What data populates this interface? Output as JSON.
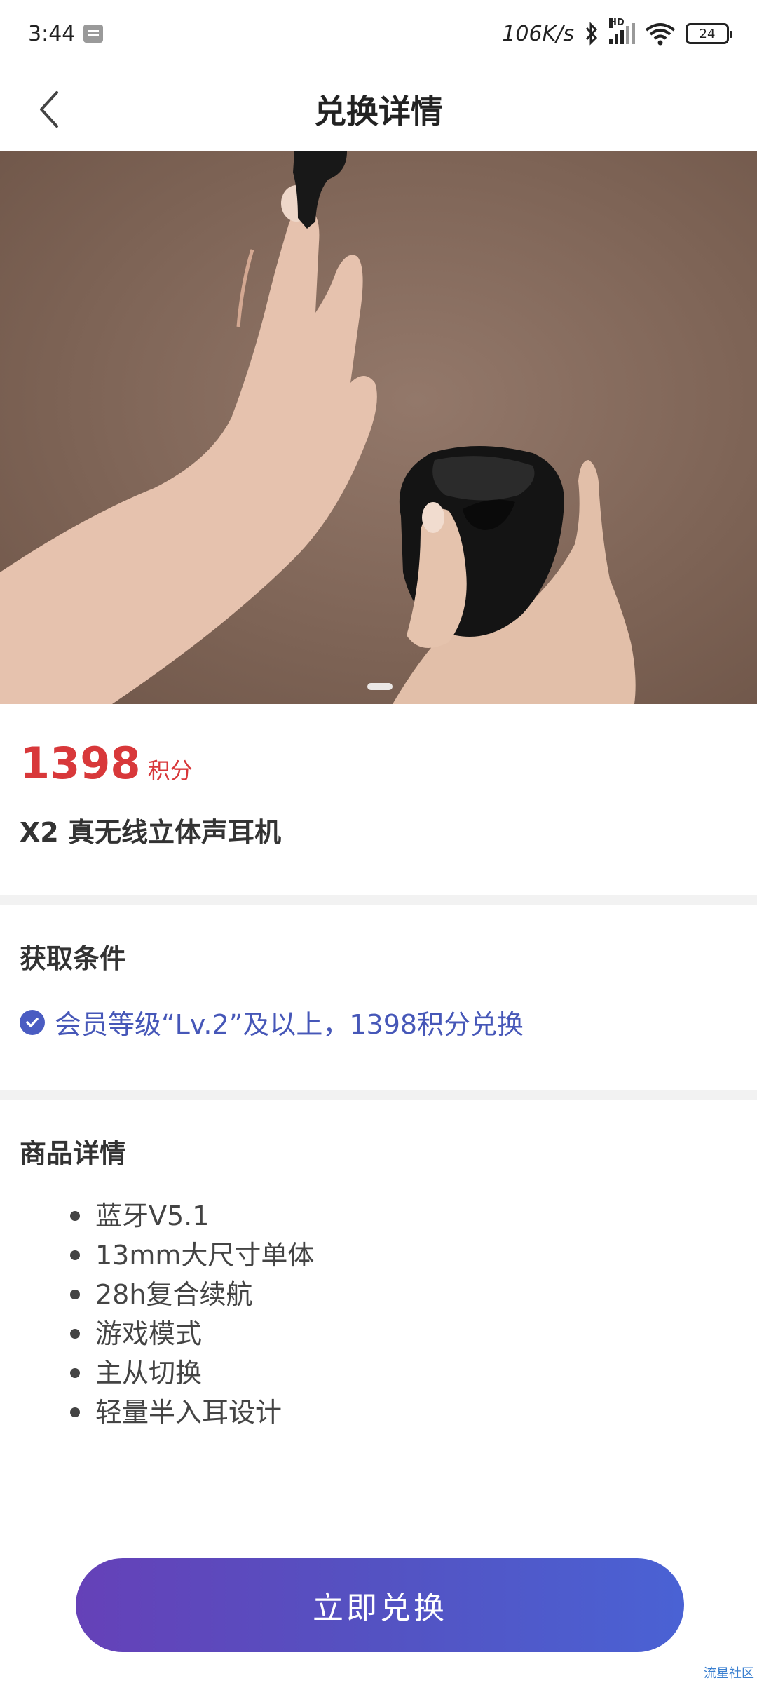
{
  "status_bar": {
    "time": "3:44",
    "net_speed": "106K/s",
    "signal_label": "HD",
    "battery": "24"
  },
  "nav": {
    "title": "兑换详情"
  },
  "product": {
    "price": "1398",
    "price_unit": "积分",
    "name": "X2 真无线立体声耳机"
  },
  "conditions": {
    "title": "获取条件",
    "text": "会员等级“Lv.2”及以上，1398积分兑换"
  },
  "details": {
    "title": "商品详情",
    "features": [
      "蓝牙V5.1",
      "13mm大尺寸单体",
      "28h复合续航",
      "游戏模式",
      "主从切换",
      "轻量半入耳设计"
    ]
  },
  "action": {
    "redeem_label": "立即兑换"
  },
  "watermark": "流星社区",
  "colors": {
    "price": "#d8383a",
    "condition": "#4657b8",
    "button_start": "#6541b8",
    "button_end": "#4a62d4"
  }
}
